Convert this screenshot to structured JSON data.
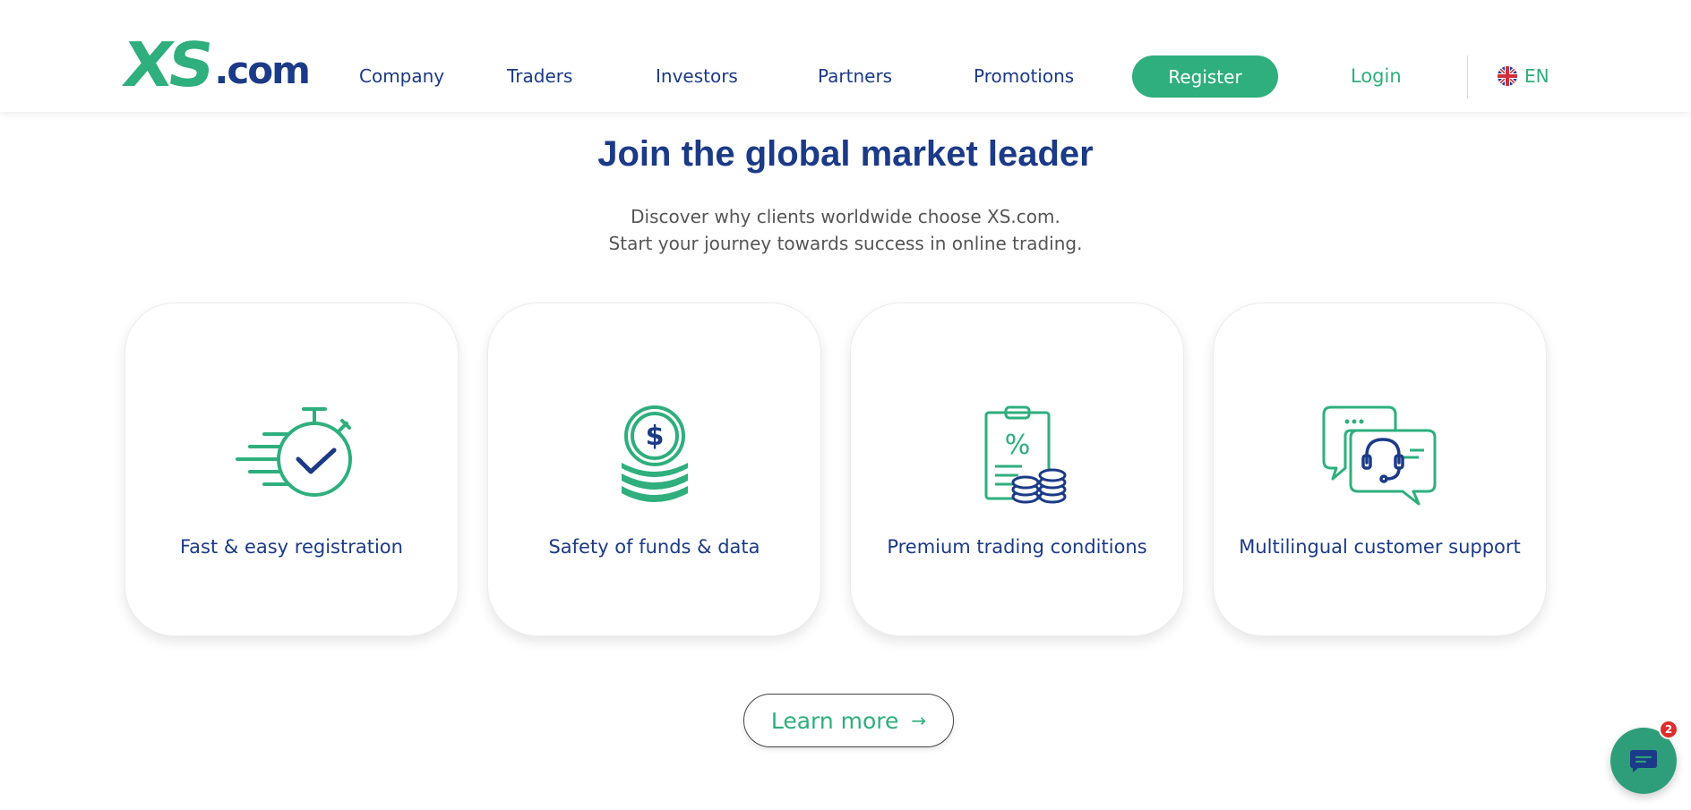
{
  "header": {
    "logo_main": "XS",
    "logo_suffix": ".com",
    "nav": [
      "Company",
      "Traders",
      "Investors",
      "Partners",
      "Promotions"
    ],
    "register_label": "Register",
    "login_label": "Login",
    "language_code": "EN"
  },
  "hero": {
    "title": "Join the global market leader",
    "subtitle_line1": "Discover why clients worldwide choose XS.com.",
    "subtitle_line2": "Start your journey towards success in online trading."
  },
  "features": [
    {
      "label": "Fast & easy registration",
      "icon": "stopwatch-check-icon"
    },
    {
      "label": "Safety of funds & data",
      "icon": "coin-stack-dollar-icon"
    },
    {
      "label": "Premium trading conditions",
      "icon": "clipboard-percent-coins-icon"
    },
    {
      "label": "Multilingual customer support",
      "icon": "chat-headset-icon"
    }
  ],
  "learn_more": {
    "label": "Learn more",
    "arrow": "→"
  },
  "chat_widget": {
    "badge_count": "2"
  },
  "colors": {
    "brand_green": "#2eaf7d",
    "brand_navy": "#1b3a87",
    "badge_red": "#e02c2c"
  }
}
